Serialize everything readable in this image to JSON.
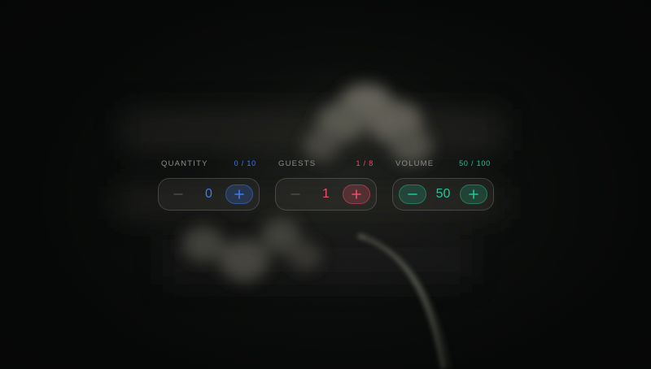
{
  "steppers": [
    {
      "label": "QUANTITY",
      "count": "0 / 10",
      "value": "0",
      "accent": "#3d7bf2",
      "minus_enabled": false,
      "plus_enabled": true
    },
    {
      "label": "GUESTS",
      "count": "1 / 8",
      "value": "1",
      "accent": "#ee4d6b",
      "minus_enabled": false,
      "plus_enabled": true
    },
    {
      "label": "VOLUME",
      "count": "50 / 100",
      "value": "50",
      "accent": "#22c597",
      "minus_enabled": true,
      "plus_enabled": true
    }
  ],
  "icons": {
    "minus": "minus-icon",
    "plus": "plus-icon"
  },
  "background": {
    "image": "blurred white flowers on dark background"
  }
}
